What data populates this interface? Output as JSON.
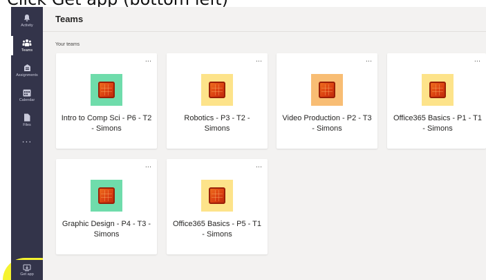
{
  "caption": "Click Get app (bottom left)",
  "sidebar": {
    "items": [
      {
        "label": "Activity",
        "icon": "bell-icon"
      },
      {
        "label": "Teams",
        "icon": "teams-icon"
      },
      {
        "label": "Assignments",
        "icon": "assignments-icon"
      },
      {
        "label": "Calendar",
        "icon": "calendar-icon"
      },
      {
        "label": "Files",
        "icon": "files-icon"
      }
    ],
    "more": "...",
    "get_app": "Get app"
  },
  "main": {
    "title": "Teams",
    "section_label": "Your teams",
    "more_label": "...",
    "teams": [
      {
        "name": "Intro to Comp Sci - P6 - T2 - Simons",
        "tile_color": "#6fdcab"
      },
      {
        "name": "Robotics - P3 - T2 - Simons",
        "tile_color": "#fde38a"
      },
      {
        "name": "Video Production - P2 - T3 - Simons",
        "tile_color": "#f8bd74"
      },
      {
        "name": "Office365 Basics - P1 - T1 - Simons",
        "tile_color": "#fde38a"
      },
      {
        "name": "Graphic Design - P4 - T3 - Simons",
        "tile_color": "#6fdcab"
      },
      {
        "name": "Office365 Basics - P5 - T1 - Simons",
        "tile_color": "#fde38a"
      }
    ]
  },
  "colors": {
    "rail": "#33344a",
    "background": "#f3f2f1",
    "highlight": "#f5f330"
  }
}
